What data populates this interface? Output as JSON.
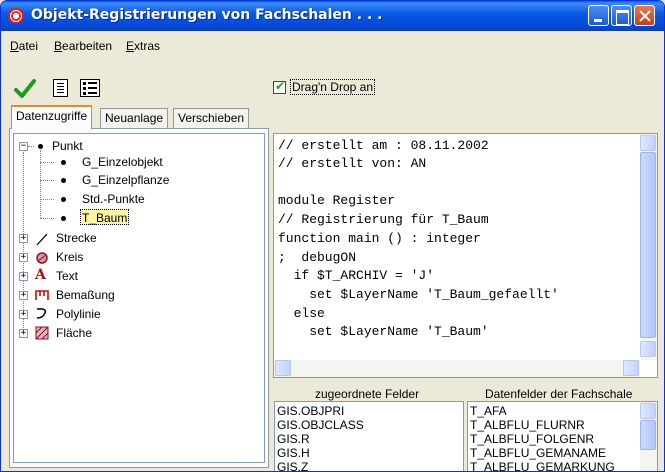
{
  "window": {
    "title": "Objekt-Registrierungen von Fachschalen . . ."
  },
  "menu": [
    "Datei",
    "Bearbeiten",
    "Extras"
  ],
  "toolbar": {
    "confirm_icon": "checkmark-icon",
    "doc_icon": "document-icon",
    "form_icon": "form-icon",
    "drag_drop_label": "Drag'n Drop an",
    "drag_drop_checked": true
  },
  "tabs": [
    "Datenzugriffe",
    "Neuanlage",
    "Verschieben"
  ],
  "active_tab": "Datenzugriffe",
  "tree": {
    "punkt": {
      "label": "Punkt",
      "children": [
        "G_Einzelobjekt",
        "G_Einzelpflanze",
        "Std.-Punkte",
        "T_Baum"
      ],
      "selected": "T_Baum"
    },
    "items": [
      {
        "label": "Strecke",
        "icon": "line-icon"
      },
      {
        "label": "Kreis",
        "icon": "circle-icon"
      },
      {
        "label": "Text",
        "icon": "text-icon"
      },
      {
        "label": "Bemaßung",
        "icon": "dimension-icon"
      },
      {
        "label": "Polylinie",
        "icon": "polyline-icon"
      },
      {
        "label": "Fläche",
        "icon": "area-icon"
      }
    ]
  },
  "code": [
    "// erstellt am : 08.11.2002",
    "// erstellt von: AN",
    "",
    "module Register",
    "// Registrierung für T_Baum",
    "function main () : integer",
    ";  debugON",
    "  if $T_ARCHIV = 'J'",
    "    set $LayerName 'T_Baum_gefaellt'",
    "  else",
    "    set $LayerName 'T_Baum'"
  ],
  "lists": {
    "assigned_label": "zugeordnete Felder",
    "assigned": [
      "GIS.OBJPRI",
      "GIS.OBJCLASS",
      "GIS.R",
      "GIS.H",
      "GIS.Z"
    ],
    "fields_label": "Datenfelder der Fachschale",
    "fields": [
      "T_AFA",
      "T_ALBFLU_FLURNR",
      "T_ALBFLU_FOLGENR",
      "T_ALBFLU_GEMANAME",
      "T_ALBFLU_GEMARKUNG"
    ]
  }
}
